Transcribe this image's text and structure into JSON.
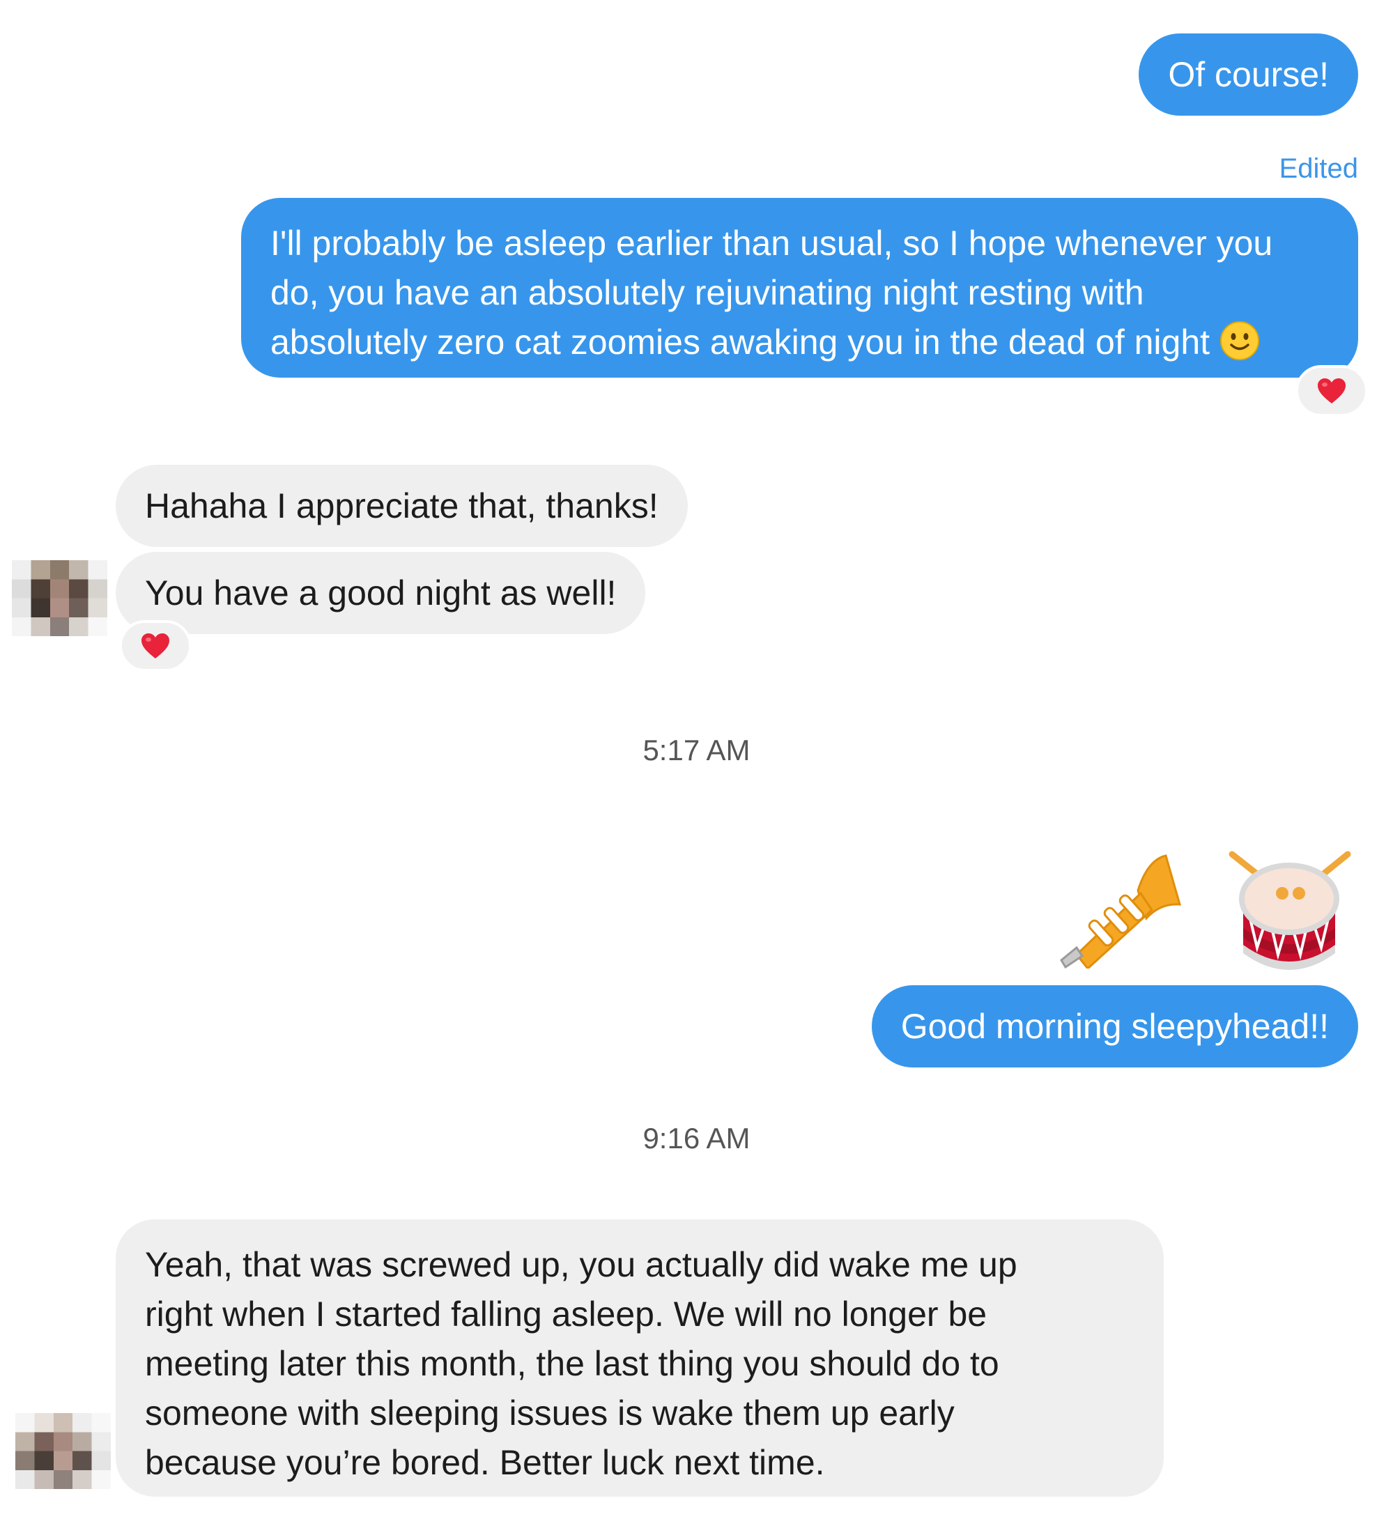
{
  "conversation": {
    "messages": [
      {
        "id": "m1",
        "side": "outgoing",
        "text": "Of course!"
      },
      {
        "id": "m2",
        "side": "outgoing",
        "edited_label": "Edited",
        "lines": [
          "I'll probably be asleep earlier than usual, so I hope whenever you",
          "do, you have an absolutely rejuvinating night resting with",
          "absolutely zero cat zoomies awaking you in the dead of night"
        ],
        "trailing_emoji": "slightly-smiling-face-icon",
        "reaction": "heart-icon"
      },
      {
        "id": "m3",
        "side": "incoming",
        "text": "Hahaha I appreciate that, thanks!"
      },
      {
        "id": "m4",
        "side": "incoming",
        "text": "You have a good night as well!",
        "reaction": "heart-icon"
      },
      {
        "id": "m5",
        "side": "outgoing",
        "emojis": [
          "trumpet-icon",
          "drum-icon"
        ]
      },
      {
        "id": "m6",
        "side": "outgoing",
        "text": "Good morning sleepyhead!!"
      },
      {
        "id": "m7",
        "side": "incoming",
        "lines": [
          "Yeah, that was screwed up, you actually did wake me up",
          "right when I started falling asleep. We will no longer be",
          "meeting later this month, the last thing you should do to",
          "someone with sleeping issues is wake them up early",
          "because you’re bored. Better luck next time."
        ]
      }
    ],
    "timestamps": [
      "5:17 AM",
      "9:16 AM"
    ]
  },
  "colors": {
    "outgoing_bubble": "#3796ec",
    "incoming_bubble": "#efefef",
    "edited_label": "#3c95e8",
    "reaction_heart": "#e8233a"
  }
}
